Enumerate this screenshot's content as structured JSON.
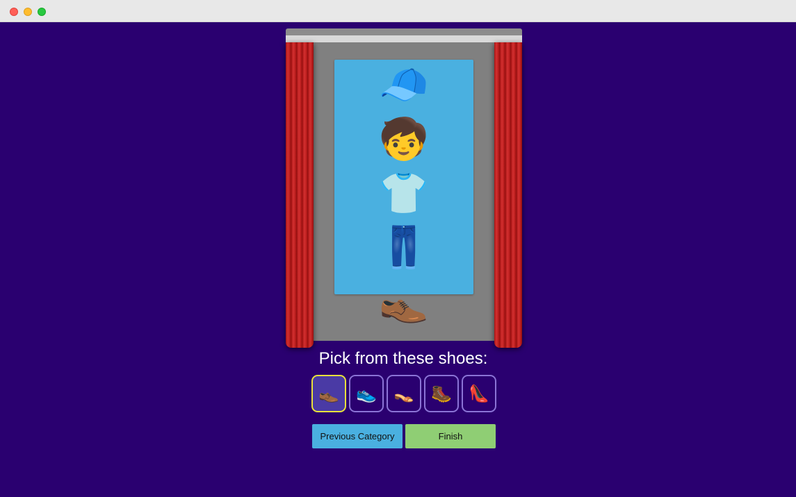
{
  "window": {
    "controls": [
      "close",
      "minimize",
      "maximize"
    ]
  },
  "stage": {
    "hat": "🧢",
    "face": "🧒",
    "top": "👕",
    "bottom": "👖",
    "shoes": "👞"
  },
  "prompt": "Pick from these shoes:",
  "options": [
    "👞",
    "👟",
    "👡",
    "🥾",
    "👠"
  ],
  "selected_index": 0,
  "buttons": {
    "previous": "Previous Category",
    "finish": "Finish"
  },
  "colors": {
    "background": "#2a0070",
    "mirror": "#4ab0e0",
    "selected_border": "#e9e23a",
    "previous_button": "#4ab0e0",
    "finish_button": "#8fce74"
  }
}
